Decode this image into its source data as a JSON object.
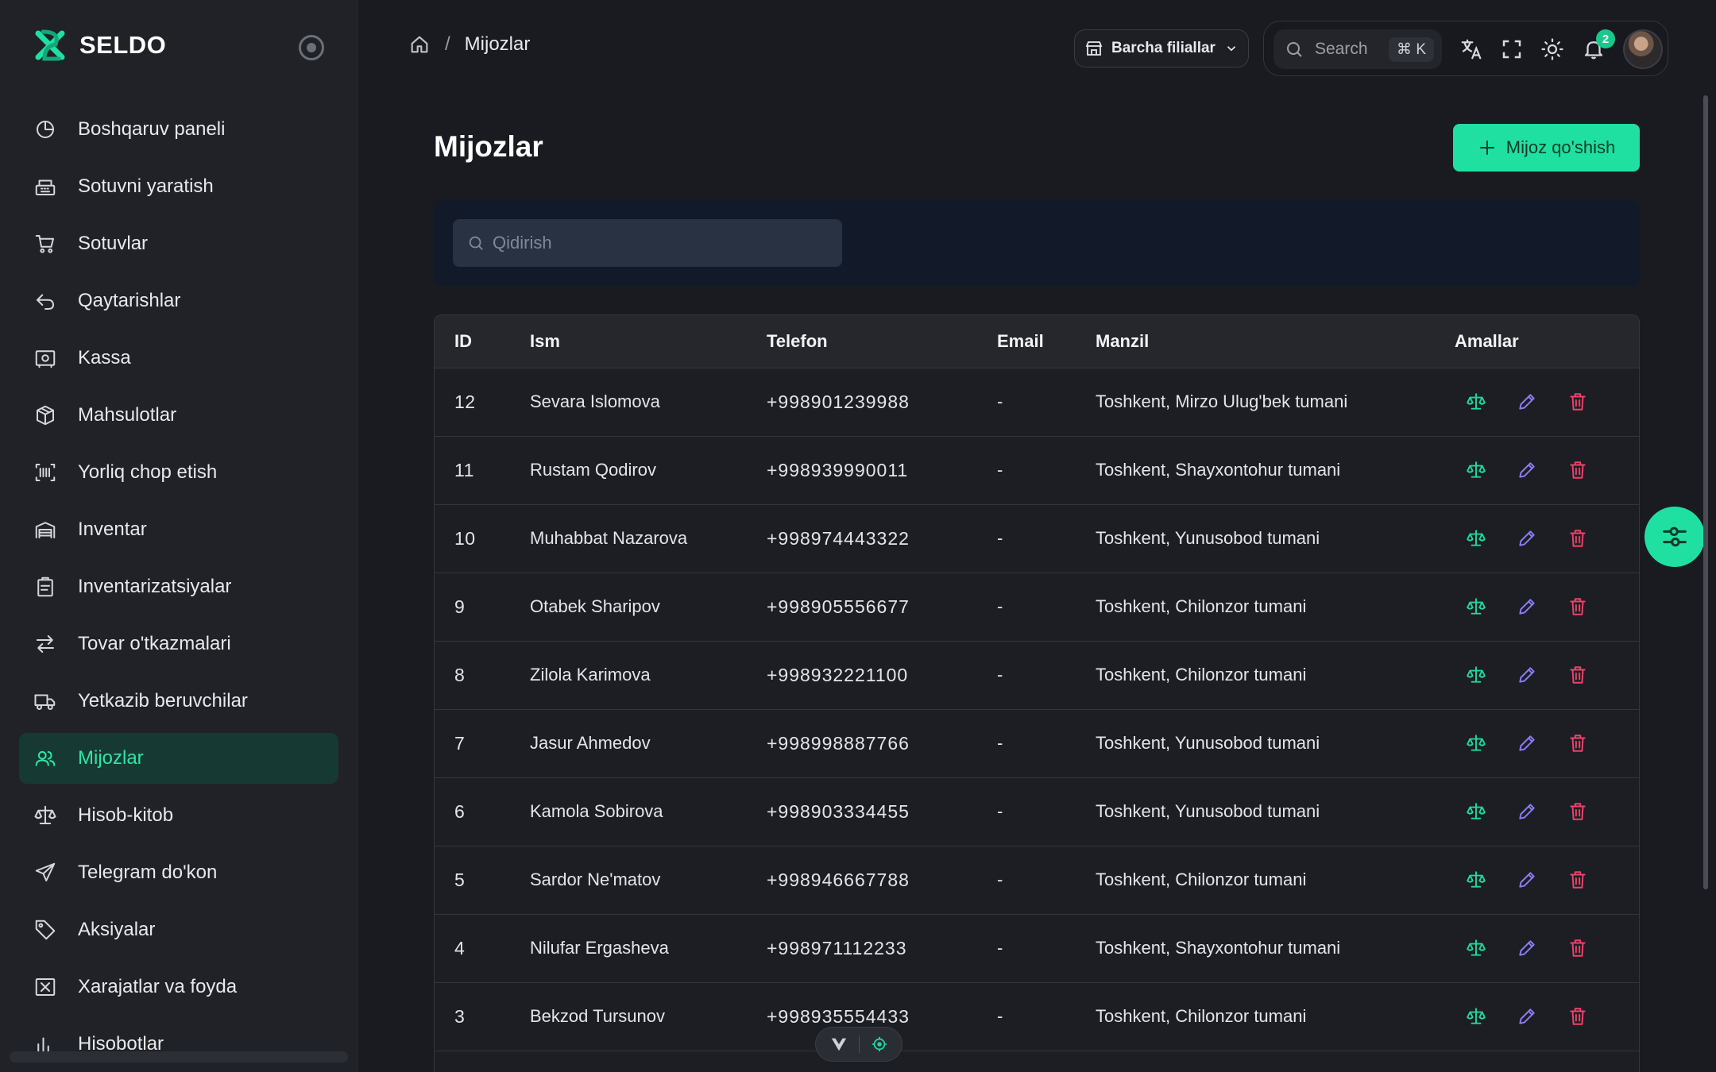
{
  "app": {
    "brand": "SELDO",
    "accent_color": "#1fe0a0"
  },
  "sidebar": {
    "items": [
      {
        "label": "Boshqaruv paneli",
        "icon": "pie-chart-icon"
      },
      {
        "label": "Sotuvni yaratish",
        "icon": "cash-register-icon"
      },
      {
        "label": "Sotuvlar",
        "icon": "cart-icon"
      },
      {
        "label": "Qaytarishlar",
        "icon": "undo-icon"
      },
      {
        "label": "Kassa",
        "icon": "safe-icon"
      },
      {
        "label": "Mahsulotlar",
        "icon": "box-icon"
      },
      {
        "label": "Yorliq chop etish",
        "icon": "barcode-icon"
      },
      {
        "label": "Inventar",
        "icon": "warehouse-icon"
      },
      {
        "label": "Inventarizatsiyalar",
        "icon": "clipboard-icon"
      },
      {
        "label": "Tovar o'tkazmalari",
        "icon": "transfer-icon"
      },
      {
        "label": "Yetkazib beruvchilar",
        "icon": "truck-icon"
      },
      {
        "label": "Mijozlar",
        "icon": "users-icon",
        "active": true
      },
      {
        "label": "Hisob-kitob",
        "icon": "balance-icon"
      },
      {
        "label": "Telegram do'kon",
        "icon": "send-icon"
      },
      {
        "label": "Aksiyalar",
        "icon": "tag-icon"
      },
      {
        "label": "Xarajatlar va foyda",
        "icon": "expense-icon"
      },
      {
        "label": "Hisobotlar",
        "icon": "report-icon"
      }
    ]
  },
  "header": {
    "breadcrumb_current": "Mijozlar",
    "breadcrumb_separator": "/",
    "branch_select": "Barcha filiallar",
    "search_placeholder": "Search",
    "search_shortcut": "⌘ K",
    "notification_count": "2"
  },
  "main": {
    "title": "Mijozlar",
    "add_button": "Mijoz qo'shish",
    "filter_placeholder": "Qidirish",
    "columns": [
      "ID",
      "Ism",
      "Telefon",
      "Email",
      "Manzil",
      "Amallar"
    ],
    "rows": [
      {
        "id": "12",
        "name": "Sevara Islomova",
        "phone": "+998901239988",
        "email": "-",
        "address": "Toshkent, Mirzo Ulug'bek tumani"
      },
      {
        "id": "11",
        "name": "Rustam Qodirov",
        "phone": "+998939990011",
        "email": "-",
        "address": "Toshkent, Shayxontohur tumani"
      },
      {
        "id": "10",
        "name": "Muhabbat Nazarova",
        "phone": "+998974443322",
        "email": "-",
        "address": "Toshkent, Yunusobod tumani"
      },
      {
        "id": "9",
        "name": "Otabek Sharipov",
        "phone": "+998905556677",
        "email": "-",
        "address": "Toshkent, Chilonzor tumani"
      },
      {
        "id": "8",
        "name": "Zilola Karimova",
        "phone": "+998932221100",
        "email": "-",
        "address": "Toshkent, Chilonzor tumani"
      },
      {
        "id": "7",
        "name": "Jasur Ahmedov",
        "phone": "+998998887766",
        "email": "-",
        "address": "Toshkent, Yunusobod tumani"
      },
      {
        "id": "6",
        "name": "Kamola Sobirova",
        "phone": "+998903334455",
        "email": "-",
        "address": "Toshkent, Yunusobod tumani"
      },
      {
        "id": "5",
        "name": "Sardor Ne'matov",
        "phone": "+998946667788",
        "email": "-",
        "address": "Toshkent, Chilonzor tumani"
      },
      {
        "id": "4",
        "name": "Nilufar Ergasheva",
        "phone": "+998971112233",
        "email": "-",
        "address": "Toshkent, Shayxontohur tumani"
      },
      {
        "id": "3",
        "name": "Bekzod Tursunov",
        "phone": "+998935554433",
        "email": "-",
        "address": "Toshkent, Chilonzor tumani"
      },
      {
        "id": "",
        "name": "",
        "phone": "",
        "email": "",
        "address": ""
      }
    ]
  }
}
